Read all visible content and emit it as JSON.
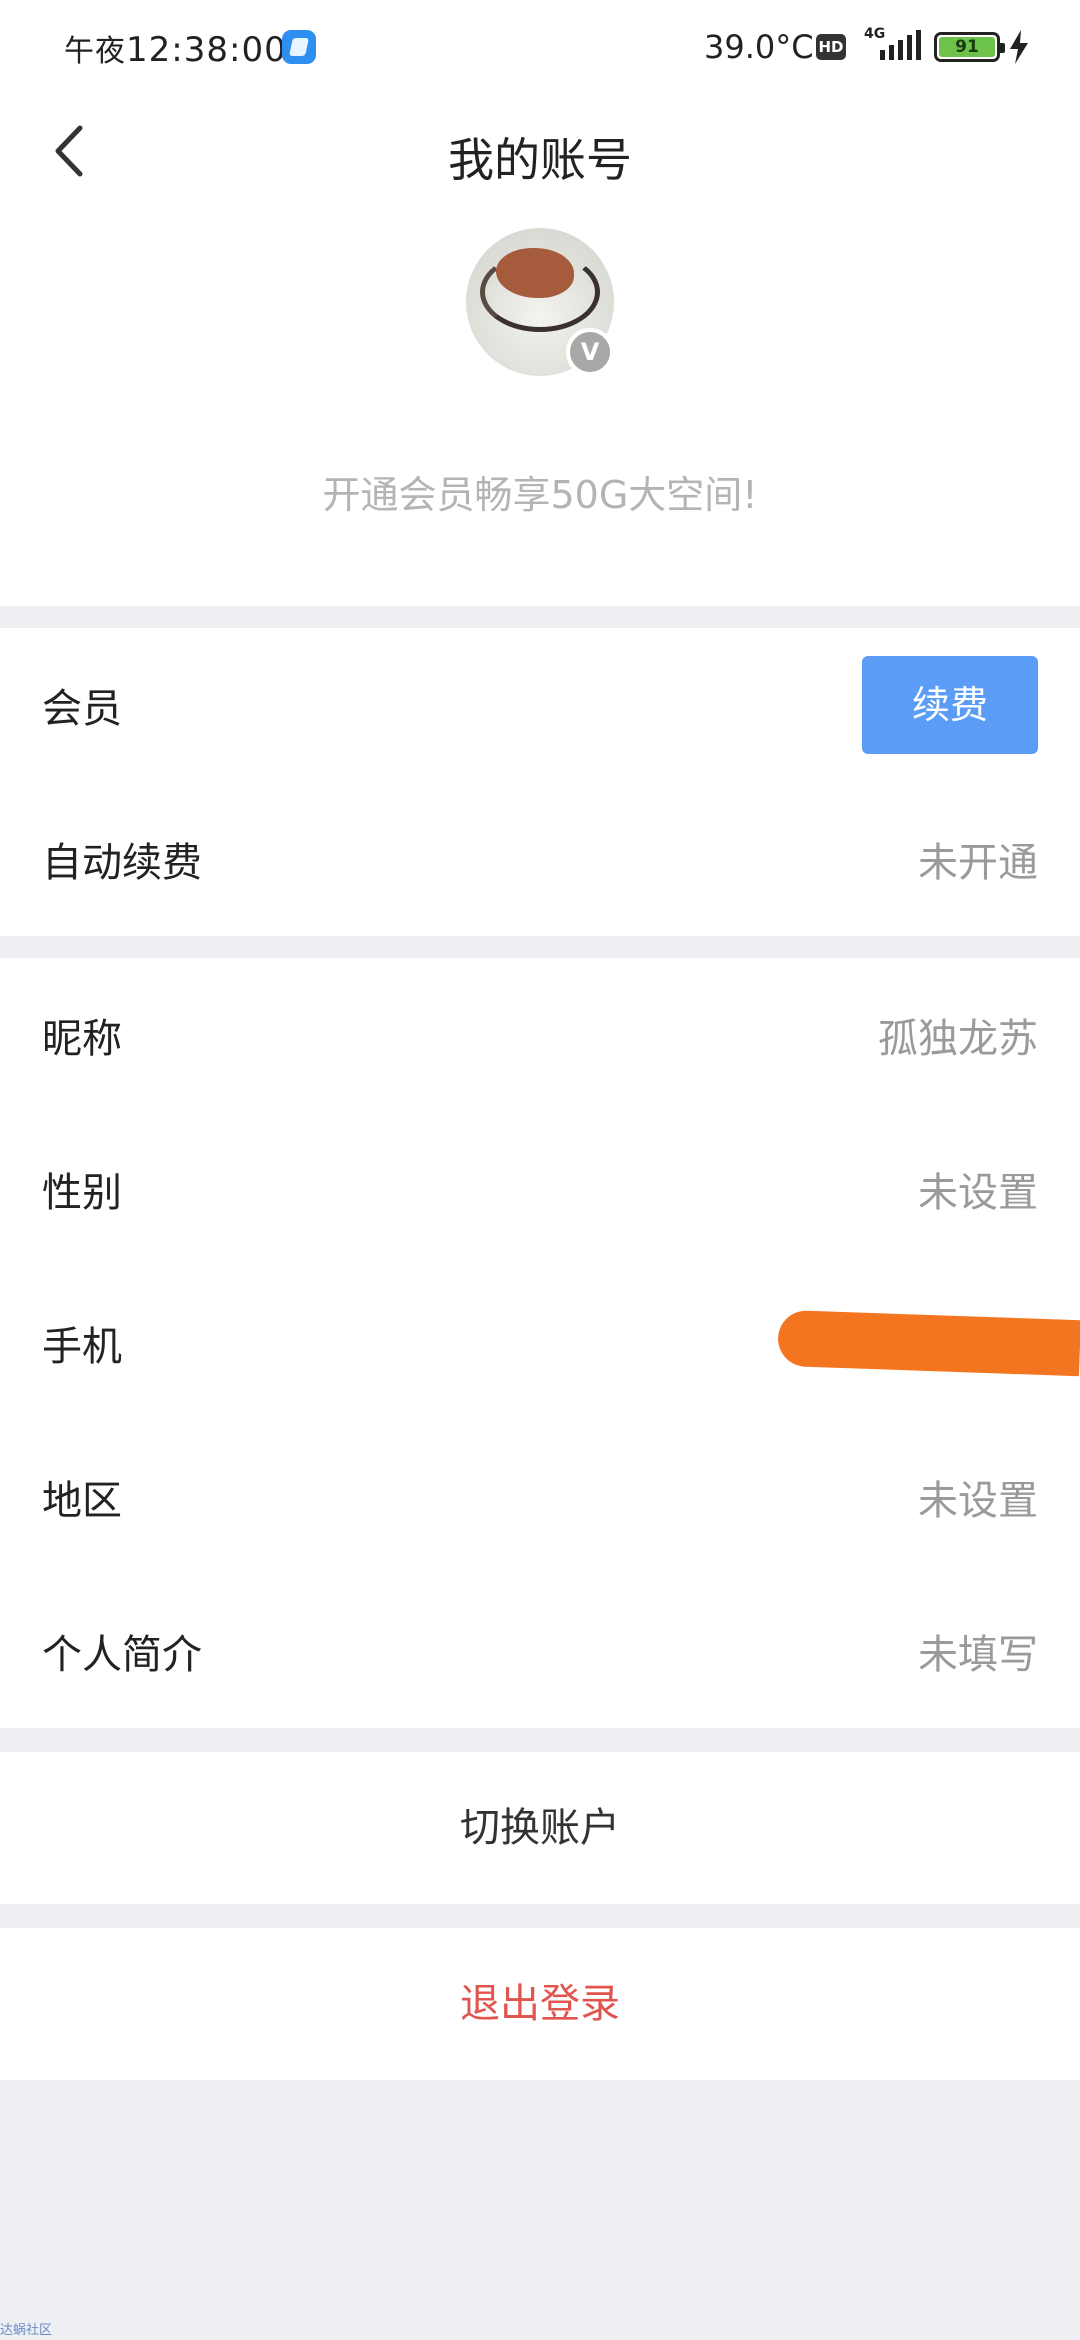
{
  "status_bar": {
    "time_prefix": "午夜",
    "time": "12:38:00",
    "temperature": "39.0°C",
    "hd_label": "HD",
    "network": "4G",
    "battery": "91"
  },
  "header": {
    "title": "我的账号",
    "vip_badge": "V",
    "promo": "开通会员畅享50G大空间!"
  },
  "membership": {
    "member_label": "会员",
    "renew_button": "续费",
    "auto_renew_label": "自动续费",
    "auto_renew_value": "未开通"
  },
  "profile": {
    "nickname_label": "昵称",
    "nickname_value": "孤独龙苏",
    "gender_label": "性别",
    "gender_value": "未设置",
    "phone_label": "手机",
    "region_label": "地区",
    "region_value": "未设置",
    "bio_label": "个人简介",
    "bio_value": "未填写"
  },
  "actions": {
    "switch_account": "切换账户",
    "logout": "退出登录"
  },
  "watermark": "达蜗社区",
  "colors": {
    "accent_blue": "#5b9cf7",
    "logout_red": "#e0564f",
    "background_gray": "#eeeff3",
    "redaction_orange": "#f47520"
  }
}
